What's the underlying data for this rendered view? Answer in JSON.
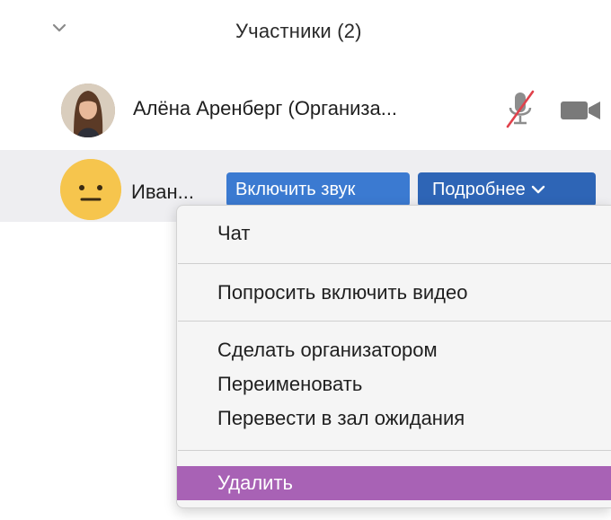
{
  "header": {
    "title": "Участники (2)",
    "collapse_icon": "chevron-down-icon"
  },
  "participants": [
    {
      "name": "Алёна Аренберг (Организа...",
      "avatar": "photo-avatar",
      "mic": "mic-muted-icon",
      "camera": "video-camera-icon"
    },
    {
      "name": "Иван...",
      "avatar": "neutral-face-avatar",
      "unmute_label": "Включить звук",
      "more_label": "Подробнее"
    }
  ],
  "menu": {
    "items": [
      "Чат",
      "Попросить включить видео",
      "Сделать организатором",
      "Переименовать",
      "Перевести в зал ожидания",
      "Удалить"
    ]
  },
  "colors": {
    "button_blue": "#2e65b6",
    "selected_highlight": "#a862b5",
    "avatar_yellow": "#f6c54d",
    "muted_red": "#e0414b"
  }
}
